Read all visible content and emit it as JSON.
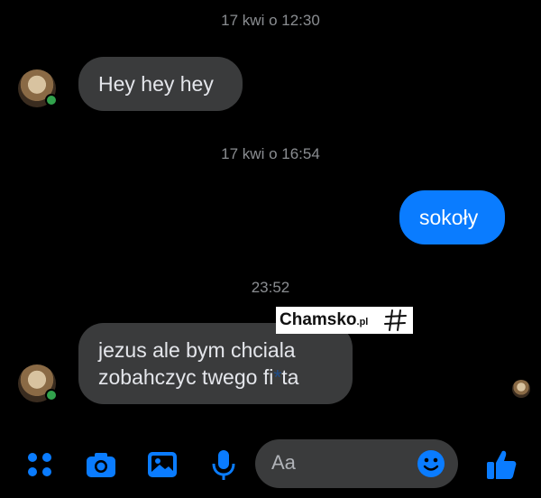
{
  "chat": {
    "timestamps": [
      "17 kwi o 12:30",
      "17 kwi o 16:54",
      "23:52"
    ],
    "messages": [
      {
        "from": "them",
        "text": "Hey hey hey"
      },
      {
        "from": "me",
        "text": "sokoły"
      },
      {
        "from": "them",
        "lines": [
          "jezus ale bym chciala",
          "zobahczyc twego fi"
        ],
        "line2_tail": "ta"
      }
    ]
  },
  "watermark": {
    "brand": "Chamsko",
    "suffix": ".pl"
  },
  "composer": {
    "placeholder": "Aa",
    "icons": [
      "menu-dots-icon",
      "camera-icon",
      "gallery-icon",
      "mic-icon",
      "emoji-icon",
      "like-icon"
    ]
  },
  "colors": {
    "background": "#000000",
    "incoming_bubble": "#3a3b3c",
    "outgoing_bubble": "#0a7cff",
    "accent": "#0a7cff",
    "online": "#31a24c"
  }
}
